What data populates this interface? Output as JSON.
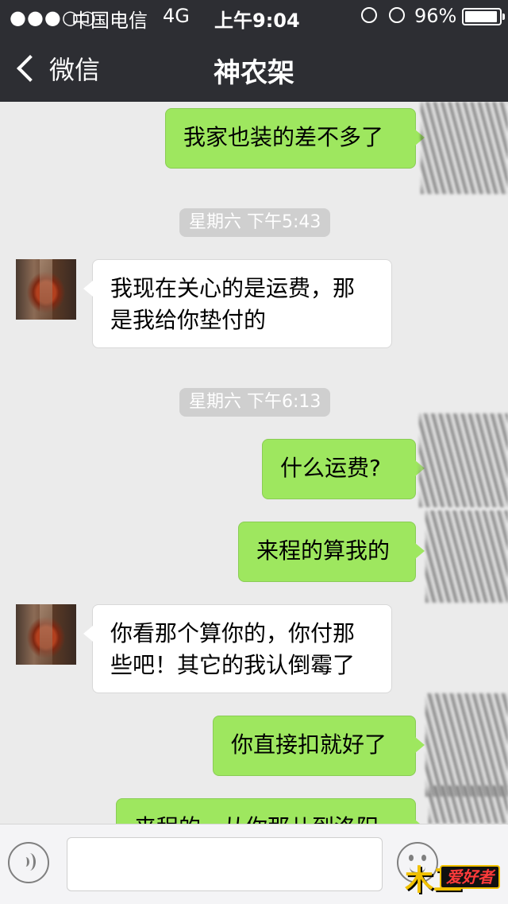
{
  "status_bar": {
    "signal": "●●●○○",
    "carrier": "中国电信",
    "network": "4G",
    "time": "上午9:04",
    "battery_percent": "96%",
    "battery_level": 0.96
  },
  "nav": {
    "back_label": "微信",
    "title": "神农架"
  },
  "messages": [
    {
      "side": "right",
      "text": "我家也装的差不多了"
    },
    {
      "type": "timestamp",
      "text": "星期六 下午5:43"
    },
    {
      "side": "left",
      "lines": [
        "我现在关心的是运费，那",
        "是我给你垫付的"
      ]
    },
    {
      "type": "timestamp",
      "text": "星期六 下午6:13"
    },
    {
      "side": "right",
      "text": "什么运费?"
    },
    {
      "side": "right",
      "text": "来程的算我的"
    },
    {
      "side": "left",
      "lines": [
        "你看那个算你的，你付那",
        "些吧！其它的我认倒霉了"
      ]
    },
    {
      "side": "right",
      "text": "你直接扣就好了"
    },
    {
      "side": "right",
      "text": "来程的，从你那儿到洛阳"
    }
  ],
  "input_bar": {
    "voice_icon": "voice-icon",
    "emoji_icon": "emoji-icon"
  },
  "watermark": {
    "mark": "木工",
    "text": "爱好者"
  }
}
